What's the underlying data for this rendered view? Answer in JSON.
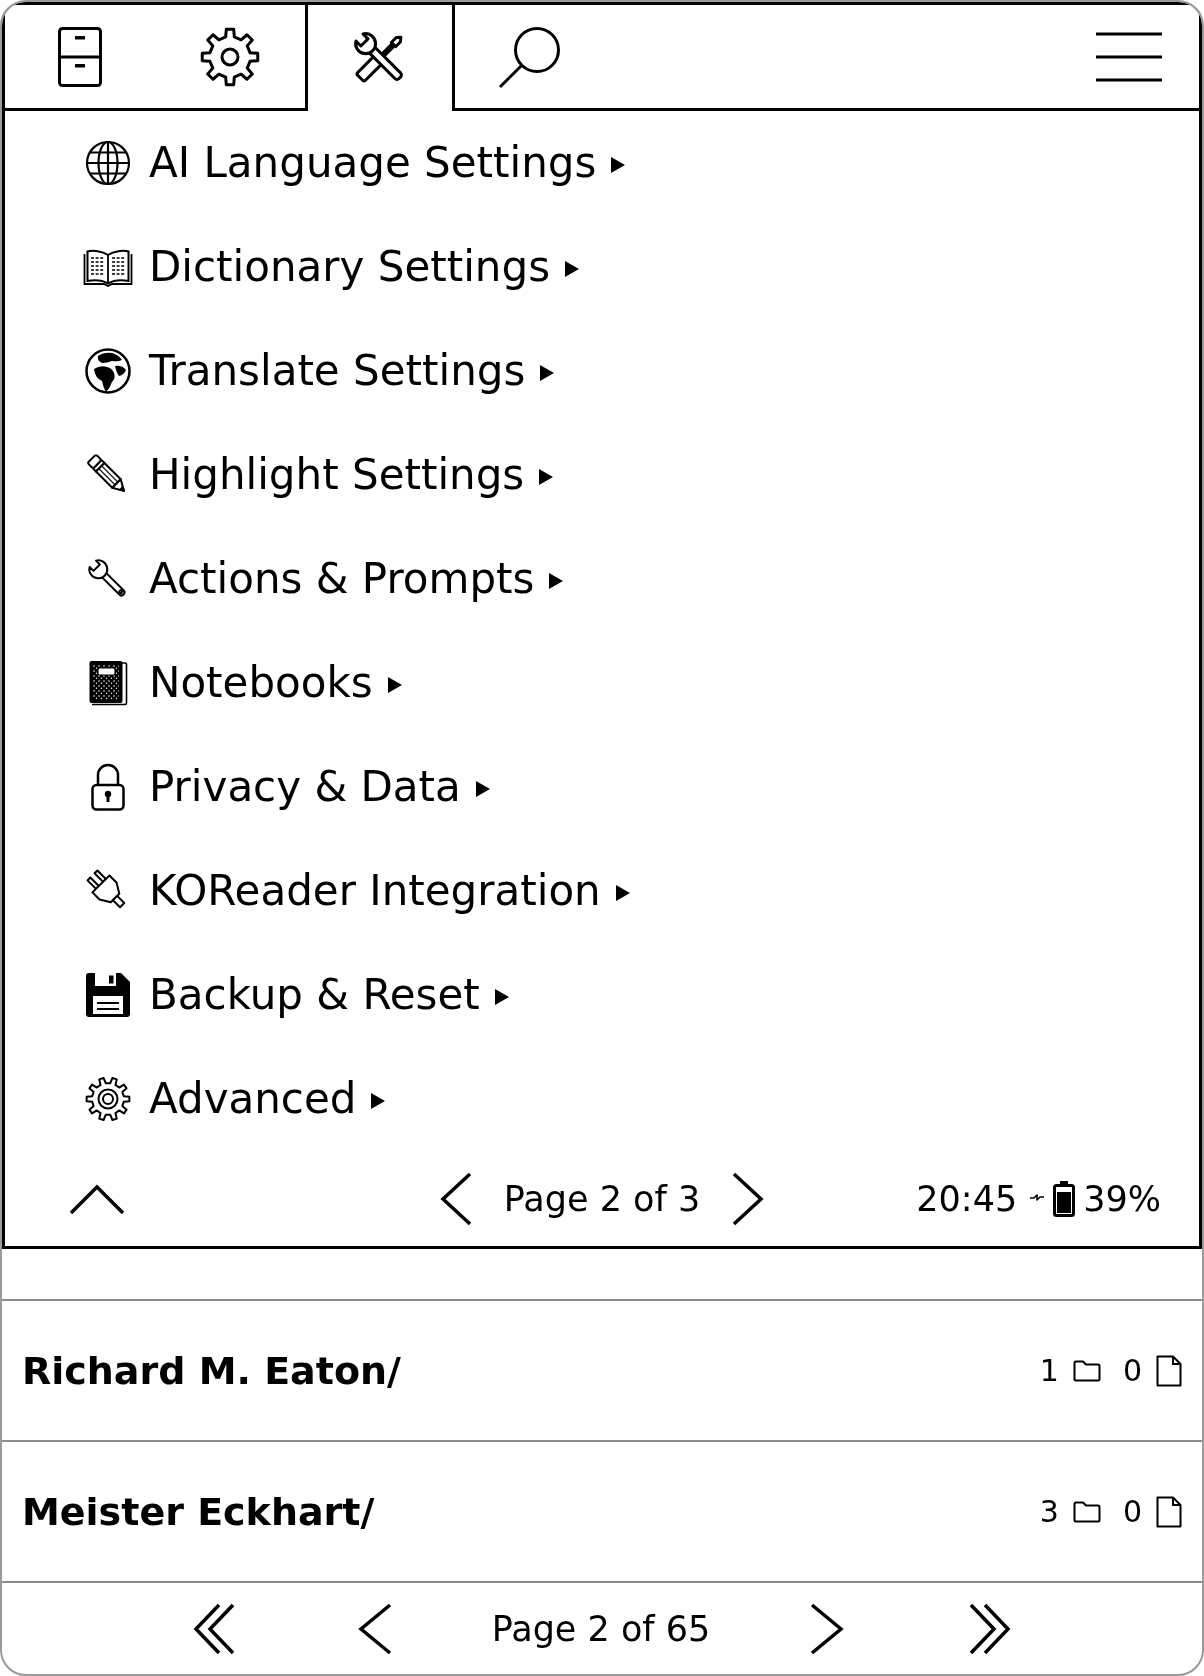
{
  "menu": {
    "tabs": [
      {
        "selected": false
      },
      {
        "selected": false
      },
      {
        "selected": true
      },
      {
        "selected": false
      },
      {
        "selected": false
      }
    ],
    "items": [
      {
        "label": "AI Language Settings",
        "submenu": true
      },
      {
        "label": "Dictionary Settings",
        "submenu": true
      },
      {
        "label": "Translate Settings",
        "submenu": true
      },
      {
        "label": "Highlight Settings",
        "submenu": true
      },
      {
        "label": "Actions & Prompts",
        "submenu": true
      },
      {
        "label": "Notebooks",
        "submenu": true
      },
      {
        "label": "Privacy & Data",
        "submenu": true
      },
      {
        "label": "KOReader Integration",
        "submenu": true
      },
      {
        "label": "Backup & Reset",
        "submenu": true
      },
      {
        "label": "Advanced",
        "submenu": true
      }
    ],
    "footer": {
      "page": "Page 2 of 3",
      "time": "20:45",
      "charging": true,
      "battery": "39%"
    }
  },
  "file_list": {
    "rows": [
      {
        "name": "Richard M. Eaton/",
        "folders": "1",
        "files": "0"
      },
      {
        "name": "Meister Eckhart/",
        "folders": "3",
        "files": "0"
      }
    ]
  },
  "pagination": {
    "page": "Page 2 of 65"
  }
}
